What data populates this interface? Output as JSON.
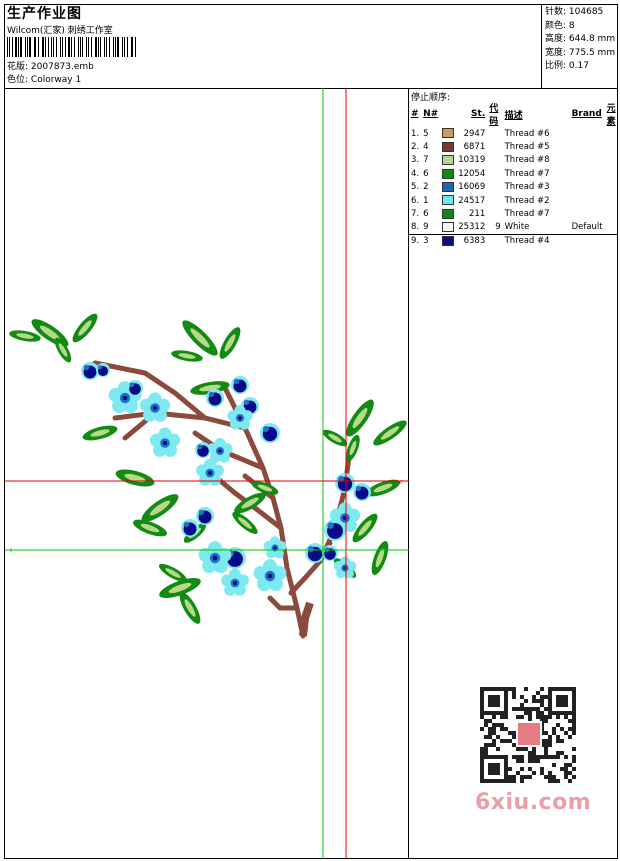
{
  "header": {
    "title": "生产作业图",
    "studio": "Wilcom(汇家) 刺绣工作室",
    "design_label": "花版:",
    "design_value": "2007873.emb",
    "colorway_label": "色位:",
    "colorway_value": "Colorway 1"
  },
  "stats": {
    "stitches_label": "针数:",
    "stitches_value": "104685",
    "colors_label": "颜色:",
    "colors_value": "8",
    "height_label": "高度:",
    "height_value": "644.8 mm",
    "width_label": "宽度:",
    "width_value": "775.5 mm",
    "scale_label": "比例:",
    "scale_value": "0.17"
  },
  "sequence": {
    "title": "停止顺序:",
    "columns": {
      "num": "#",
      "no": "N#",
      "st": "St.",
      "code": "代码",
      "desc": "描述",
      "brand": "Brand",
      "element": "元素"
    },
    "rows": [
      {
        "num": "1.",
        "no": "5",
        "color": "#c8a05a",
        "st": "2947",
        "code": "",
        "desc": "Thread #6",
        "brand": ""
      },
      {
        "num": "2.",
        "no": "4",
        "color": "#7a3a34",
        "st": "6871",
        "code": "",
        "desc": "Thread #5",
        "brand": ""
      },
      {
        "num": "3.",
        "no": "7",
        "color": "#b5d88f",
        "st": "10319",
        "code": "",
        "desc": "Thread #8",
        "brand": ""
      },
      {
        "num": "4.",
        "no": "6",
        "color": "#118a11",
        "st": "12054",
        "code": "",
        "desc": "Thread #7",
        "brand": ""
      },
      {
        "num": "5.",
        "no": "2",
        "color": "#1a66b3",
        "st": "16069",
        "code": "",
        "desc": "Thread #3",
        "brand": ""
      },
      {
        "num": "6.",
        "no": "1",
        "color": "#6fe8ef",
        "st": "24517",
        "code": "",
        "desc": "Thread #2",
        "brand": ""
      },
      {
        "num": "7.",
        "no": "6",
        "color": "#118a11",
        "st": "211",
        "code": "",
        "desc": "Thread #7",
        "brand": ""
      },
      {
        "num": "8.",
        "no": "9",
        "color": "#f4f4f4",
        "st": "25312",
        "code": "9",
        "desc": "White",
        "brand": "Default"
      },
      {
        "num": "9.",
        "no": "3",
        "color": "#0d0d8a",
        "st": "6383",
        "code": "",
        "desc": "Thread #4",
        "brand": ""
      }
    ]
  },
  "watermark": "6xiu.com",
  "colors": {
    "red_guide": "#e00000",
    "green_guide": "#00c800",
    "branch": "#8b4a3c",
    "leaf": "#138a13",
    "leaf_light": "#b8d889",
    "petal_light": "#7fe9f1",
    "petal_blue": "#1e73c6",
    "petal_navy": "#0a0a88"
  }
}
